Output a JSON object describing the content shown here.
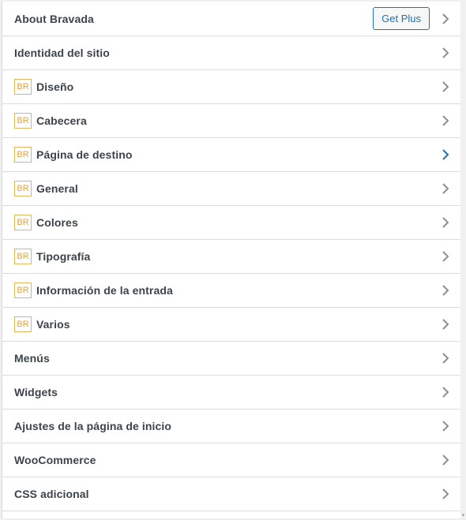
{
  "menu": {
    "items": [
      {
        "label": "About Bravada",
        "badge": "",
        "button": "Get Plus",
        "active": false
      },
      {
        "label": "Identidad del sitio",
        "badge": "",
        "active": false
      },
      {
        "label": "Diseño",
        "badge": "BR",
        "active": false
      },
      {
        "label": "Cabecera",
        "badge": "BR",
        "active": false
      },
      {
        "label": "Página de destino",
        "badge": "BR",
        "active": true
      },
      {
        "label": "General",
        "badge": "BR",
        "active": false
      },
      {
        "label": "Colores",
        "badge": "BR",
        "active": false
      },
      {
        "label": "Tipografía",
        "badge": "BR",
        "active": false
      },
      {
        "label": "Información de la entrada",
        "badge": "BR",
        "active": false
      },
      {
        "label": "Varios",
        "badge": "BR",
        "active": false
      },
      {
        "label": "Menús",
        "badge": "",
        "active": false
      },
      {
        "label": "Widgets",
        "badge": "",
        "active": false
      },
      {
        "label": "Ajustes de la página de inicio",
        "badge": "",
        "active": false
      },
      {
        "label": "WooCommerce",
        "badge": "",
        "active": false
      },
      {
        "label": "CSS adicional",
        "badge": "",
        "active": false
      }
    ]
  },
  "colors": {
    "chevron": "#8c8f94",
    "chevron_active": "#2271b1",
    "badge": "#e2a33a"
  },
  "icons": {
    "chevron": "chevron-right-icon",
    "scroll": "scroll-down-arrow-icon"
  },
  "scrollbar": {
    "arrow_glyph": "▾"
  }
}
